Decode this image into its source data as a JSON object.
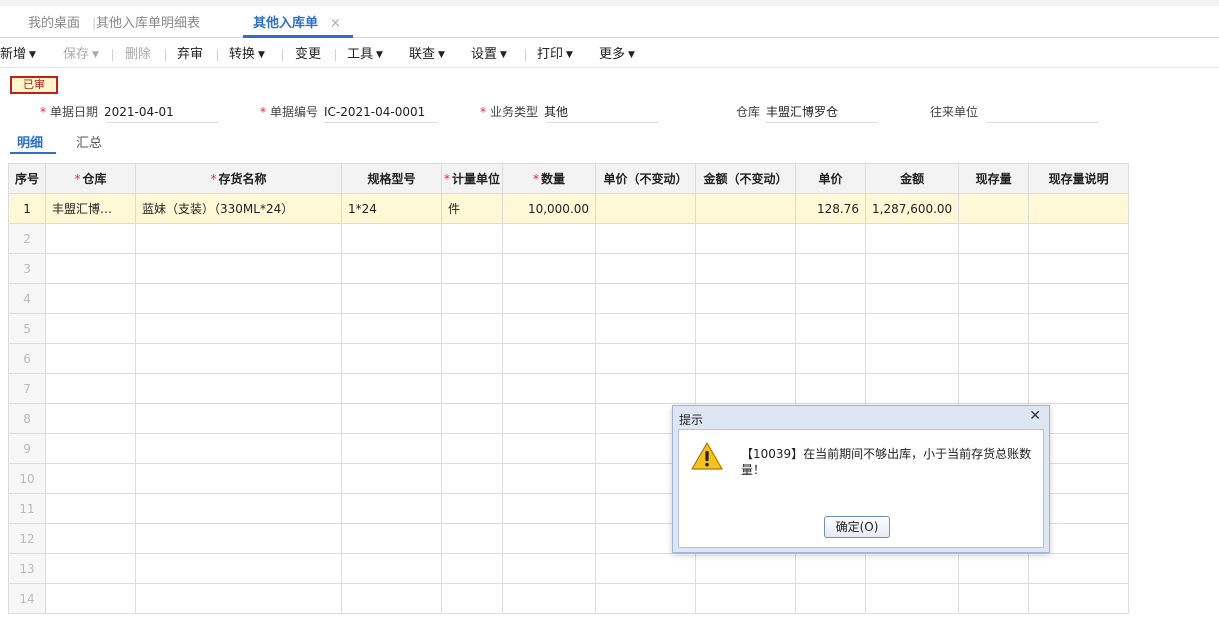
{
  "tabs": [
    {
      "label": "我的桌面"
    },
    {
      "label": "其他入库单明细表"
    },
    {
      "label": "其他入库单"
    }
  ],
  "tab_close_glyph": "×",
  "toolbar": {
    "new": "新增",
    "save": "保存",
    "delete": "删除",
    "abandon_review": "弃审",
    "convert": "转换",
    "change": "变更",
    "tools": "工具",
    "linked_query": "联查",
    "settings": "设置",
    "print": "打印",
    "more": "更多"
  },
  "status_badge": "已审",
  "form": {
    "date_label": "单据日期",
    "date_value": "2021-04-01",
    "number_label": "单据编号",
    "number_value": "IC-2021-04-0001",
    "biz_type_label": "业务类型",
    "biz_type_value": "其他",
    "warehouse_label": "仓库",
    "warehouse_value": "丰盟汇博罗仓",
    "partner_label": "往来单位",
    "partner_value": ""
  },
  "subtabs": [
    "明细",
    "汇总"
  ],
  "grid": {
    "columns": [
      "序号",
      "仓库",
      "存货名称",
      "规格型号",
      "计量单位",
      "数量",
      "单价（不变动）",
      "金额（不变动）",
      "单价",
      "金额",
      "现存量",
      "现存量说明"
    ],
    "rows": [
      [
        "1",
        "丰盟汇博…",
        "蓝妹（支装）（330ML*24）",
        "1*24",
        "件",
        "10,000.00",
        "",
        "",
        "128.76",
        "1,287,600.00",
        "",
        ""
      ]
    ],
    "empty_row_numbers": [
      "2",
      "3",
      "4",
      "5",
      "6",
      "7",
      "8",
      "9",
      "10",
      "11",
      "12",
      "13",
      "14"
    ]
  },
  "dialog": {
    "title": "提示",
    "message": "【10039】在当前期间不够出库，小于当前存货总账数量！",
    "ok_button": "确定(O)"
  },
  "colors": {
    "accent": "#2d6fc9",
    "required": "#e23",
    "badge": "#c0201a",
    "selected_row": "#fff8d6"
  }
}
